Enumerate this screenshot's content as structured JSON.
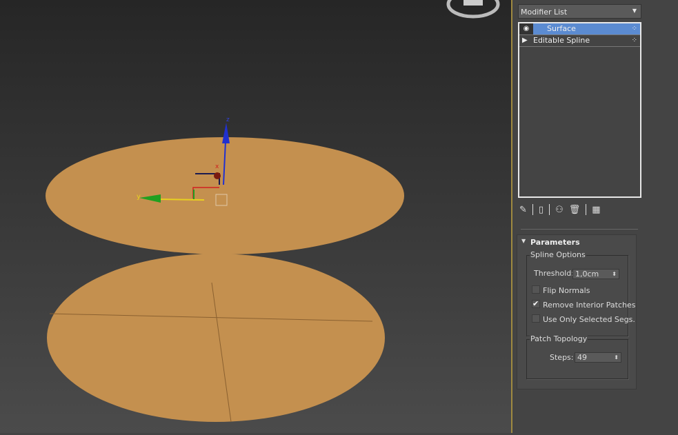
{
  "colors": {
    "surface": "#c4904f",
    "selection": "#5b8bd1",
    "x_axis": "#d02020",
    "y_axis": "#20a020",
    "z_axis": "#2030d0"
  },
  "viewport": {
    "axis_labels": {
      "x": "x",
      "y": "y",
      "z": "z"
    }
  },
  "modifier_list": {
    "label": "Modifier List"
  },
  "stack": {
    "items": [
      {
        "label": "Surface",
        "selected": true,
        "icon": "eye-icon"
      },
      {
        "label": "Editable Spline",
        "selected": false,
        "icon": "expand-triangle-icon"
      }
    ]
  },
  "toolbar": {
    "icons": [
      "pin-stack-icon",
      "show-end-result-icon",
      "make-unique-icon",
      "remove-modifier-icon",
      "configure-modifier-sets-icon"
    ]
  },
  "parameters": {
    "title": "Parameters",
    "spline_options": {
      "label": "Spline Options",
      "threshold_label": "Threshold:",
      "threshold_value": "1,0cm",
      "flip_normals": {
        "label": "Flip Normals",
        "checked": false
      },
      "remove_interior": {
        "label": "Remove Interior Patches",
        "checked": true
      },
      "use_selected": {
        "label": "Use Only Selected Segs.",
        "checked": false
      }
    },
    "patch_topology": {
      "label": "Patch Topology",
      "steps_label": "Steps:",
      "steps_value": "49"
    }
  }
}
